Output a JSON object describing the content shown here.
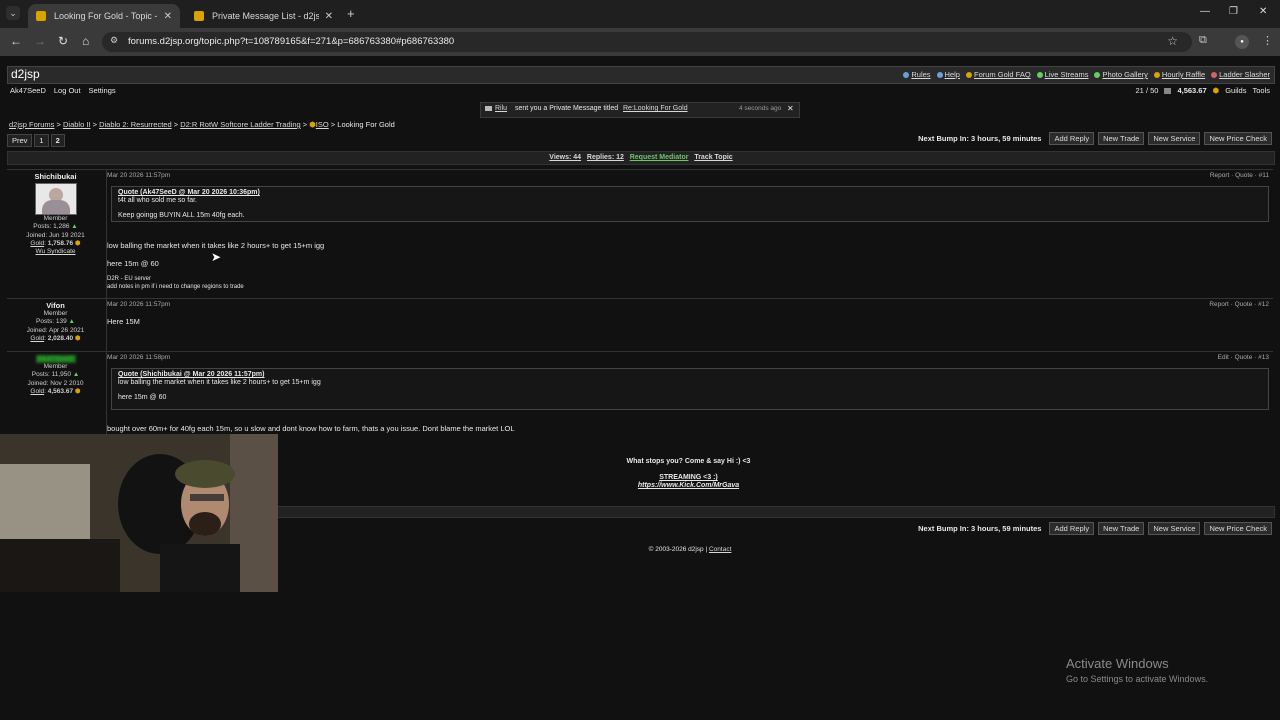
{
  "browser": {
    "tabs": [
      {
        "title": "Looking For Gold - Topic - d2jsp",
        "active": true
      },
      {
        "title": "Private Message List - d2jsp",
        "active": false
      }
    ],
    "url": "forums.d2jsp.org/topic.php?t=108789165&f=271&p=686763380#p686763380"
  },
  "site": {
    "logo": "d2jsp",
    "top_links": [
      "Rules",
      "Help",
      "Forum Gold FAQ",
      "Live Streams",
      "Photo Gallery",
      "Hourly Raffle",
      "Ladder Slasher"
    ],
    "user": "Ak47SeeD",
    "logout": "Log Out",
    "settings": "Settings",
    "pm_counter": "21 / 50",
    "gold": "4,563.67",
    "guilds": "Guilds",
    "tools": "Tools"
  },
  "notification": {
    "sender": "Rilu",
    "text": "sent you a Private Message titled",
    "subject": "Re:Looking For Gold",
    "time": "4 seconds ago"
  },
  "breadcrumb": [
    "d2jsp Forums",
    "Diablo II",
    "Diablo 2: Resurrected",
    "D2:R RotW Softcore Ladder Trading",
    "ISO",
    "Looking For Gold"
  ],
  "pager": {
    "prev": "Prev",
    "pages": [
      "1",
      "2"
    ]
  },
  "bump": {
    "text": "Next Bump In: 3 hours, 59 minutes",
    "buttons": [
      "Add Reply",
      "New Trade",
      "New Service",
      "New Price Check"
    ]
  },
  "stats": {
    "views": "Views: 44",
    "replies": "Replies: 12",
    "mediator": "Request Mediator",
    "track": "Track Topic"
  },
  "posts": [
    {
      "user": "Shichibukai",
      "rank": "Member",
      "posts": "Posts: 1,286",
      "joined": "Joined: Jun 19 2021",
      "gold_label": "Gold",
      "gold": "1,758.76",
      "guild": "Wu Syndicate",
      "time": "Mar 20 2026 11:57pm",
      "actions": [
        "Report",
        "Quote",
        "#11"
      ],
      "quote_header": "Quote (Ak47SeeD @ Mar 20 2026 10:36pm)",
      "quote_lines": [
        "t4t all who sold me so far.",
        "Keep goingg BUYIN ALL 15m 40fg each."
      ],
      "body": [
        "low balling the market when it takes like 2 hours+ to get 15+m igg",
        "here 15m @ 60"
      ],
      "sig": [
        "D2R - EU server",
        "add notes in pm if i need to change regions to trade"
      ]
    },
    {
      "user": "Vifon",
      "rank": "Member",
      "posts": "Posts: 139",
      "joined": "Joined: Apr 26 2021",
      "gold_label": "Gold",
      "gold": "2,028.40",
      "time": "Mar 20 2026 11:57pm",
      "actions": [
        "Report",
        "Quote",
        "#12"
      ],
      "body": [
        "Here 15M"
      ]
    },
    {
      "user": "Ak47SeeD",
      "rank": "Member",
      "posts": "Posts: 11,950",
      "joined": "Joined: Nov 2 2010",
      "gold_label": "Gold",
      "gold": "4,563.67",
      "time": "Mar 20 2026 11:58pm",
      "actions": [
        "Edit",
        "Quote",
        "#13"
      ],
      "quote_header": "Quote (Shichibukai @ Mar 20 2026 11:57pm)",
      "quote_lines": [
        "low balling the market when it takes like 2 hours+ to get 15+m igg",
        "here 15m @ 60"
      ],
      "body": [
        "bought over 60m+ for 40fg each 15m, so u slow and dont know how to farm, thats a you issue. Dont blame the market LOL"
      ],
      "sig": [
        "What stops you? Come & say Hi :) <3",
        "STREAMING <3 :)",
        "https://www.Kick.Com/MrGava"
      ]
    }
  ],
  "footer": {
    "copyright": "© 2003-2026 d2jsp",
    "contact": "Contact"
  },
  "watermark": {
    "title": "Activate Windows",
    "sub": "Go to Settings to activate Windows."
  }
}
